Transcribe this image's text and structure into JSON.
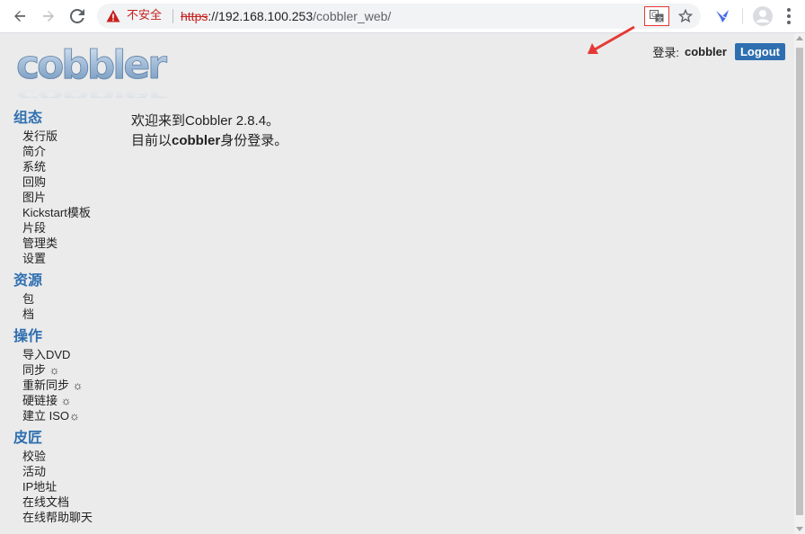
{
  "browser": {
    "security_text": "不安全",
    "url_protocol": "https",
    "url_host": "://192.168.100.253",
    "url_path": "/cobbler_web/"
  },
  "header": {
    "logo_text": "cobbler",
    "login_label": "登录:",
    "username": "cobbler",
    "logout_label": "Logout"
  },
  "sidebar": {
    "sections": [
      {
        "title": "组态",
        "items": [
          "发行版",
          "简介",
          "系统",
          "回购",
          "图片",
          "Kickstart模板",
          "片段",
          "管理类",
          "设置"
        ]
      },
      {
        "title": "资源",
        "items": [
          "包",
          "档"
        ]
      },
      {
        "title": "操作",
        "items": [
          "导入DVD",
          "同步 ☼",
          "重新同步 ☼",
          "硬链接 ☼",
          "建立 ISO☼"
        ]
      },
      {
        "title": "皮匠",
        "items": [
          "校验",
          "活动",
          "IP地址",
          "在线文档",
          "在线帮助聊天"
        ]
      }
    ]
  },
  "main": {
    "welcome": "欢迎来到Cobbler 2.8.4。",
    "login_prefix": "目前以",
    "login_user": "cobbler",
    "login_suffix": "身份登录。"
  },
  "colors": {
    "accent": "#2f6fb0",
    "page_bg": "#ebebeb",
    "warning": "#c5221f",
    "annotation_arrow": "#e53935"
  }
}
